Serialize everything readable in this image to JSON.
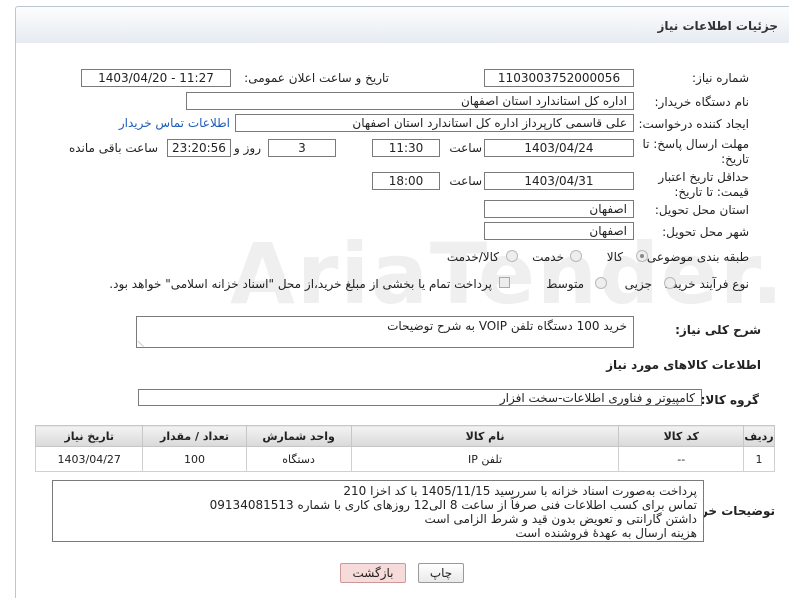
{
  "header": {
    "title": "جزئیات اطلاعات نیاز"
  },
  "fields": {
    "need_number_label": "شماره نیاز:",
    "need_number": "1103003752000056",
    "announce_label": "تاریخ و ساعت اعلان عمومی:",
    "announce_value": "1403/04/20 - 11:27",
    "buyer_org_label": "نام دستگاه خریدار:",
    "buyer_org": "اداره کل استاندارد استان اصفهان",
    "requester_label": "ایجاد کننده درخواست:",
    "requester": "علی قاسمی کارپرداز اداره کل استاندارد استان اصفهان",
    "contact_link": "اطلاعات تماس خریدار",
    "reply_deadline_label": "مهلت ارسال پاسخ: تا تاریخ:",
    "reply_date": "1403/04/24",
    "time_label": "ساعت",
    "reply_time": "11:30",
    "days": "3",
    "days_label": "روز و",
    "remaining_time": "23:20:56",
    "remaining_label": "ساعت باقی مانده",
    "validity_label": "حداقل تاریخ اعتبار قیمت: تا تاریخ:",
    "validity_date": "1403/04/31",
    "validity_time": "18:00",
    "province_label": "استان محل تحویل:",
    "province": "اصفهان",
    "city_label": "شهر محل تحویل:",
    "city": "اصفهان",
    "category_label": "طبقه بندی موضوعی:",
    "category_options": [
      "کالا",
      "خدمت",
      "کالا/خدمت"
    ],
    "purchase_label": "نوع فرآیند خرید :",
    "purchase_options": [
      "جزیی",
      "متوسط"
    ],
    "purchase_note": "پرداخت تمام یا بخشی از مبلغ خرید،از محل \"اسناد خزانه اسلامی\" خواهد بود."
  },
  "summary": {
    "label": "شرح کلی نیاز:",
    "text": "خرید 100 دستگاه تلفن VOIP به شرح توضیحات"
  },
  "goods": {
    "section_title": "اطلاعات کالاهای مورد نیاز",
    "group_label": "گروه کالا:",
    "group_value": "کامپیوتر و فناوری اطلاعات-سخت افزار",
    "columns": [
      "ردیف",
      "کد کالا",
      "نام کالا",
      "واحد شمارش",
      "تعداد / مقدار",
      "تاریخ نیاز"
    ],
    "rows": [
      {
        "row": "1",
        "code": "--",
        "name": "تلفن IP",
        "unit": "دستگاه",
        "qty": "100",
        "date": "1403/04/27"
      }
    ]
  },
  "buyer_notes": {
    "label": "توضیحات خریدار:",
    "lines": [
      "پرداخت به‌صورت اسناد خزانه با سررسید 1405/11/15 با کد اخزا 210",
      "تماس برای کسب اطلاعات فنی صرفاً از ساعت 8 الی12 روزهای کاری با شماره 09134081513",
      "داشتن گارانتی و تعویض بدون قید و شرط الزامی است",
      "هزینه ارسال به عهدهٔ فروشنده است"
    ]
  },
  "buttons": {
    "print": "چاپ",
    "back": "بازگشت"
  },
  "watermark": "AriaTender.neT",
  "colors": {
    "link": "#1e5bb8",
    "back_button_bg": "#f7dada",
    "header_bg": "#e6ebf2"
  }
}
